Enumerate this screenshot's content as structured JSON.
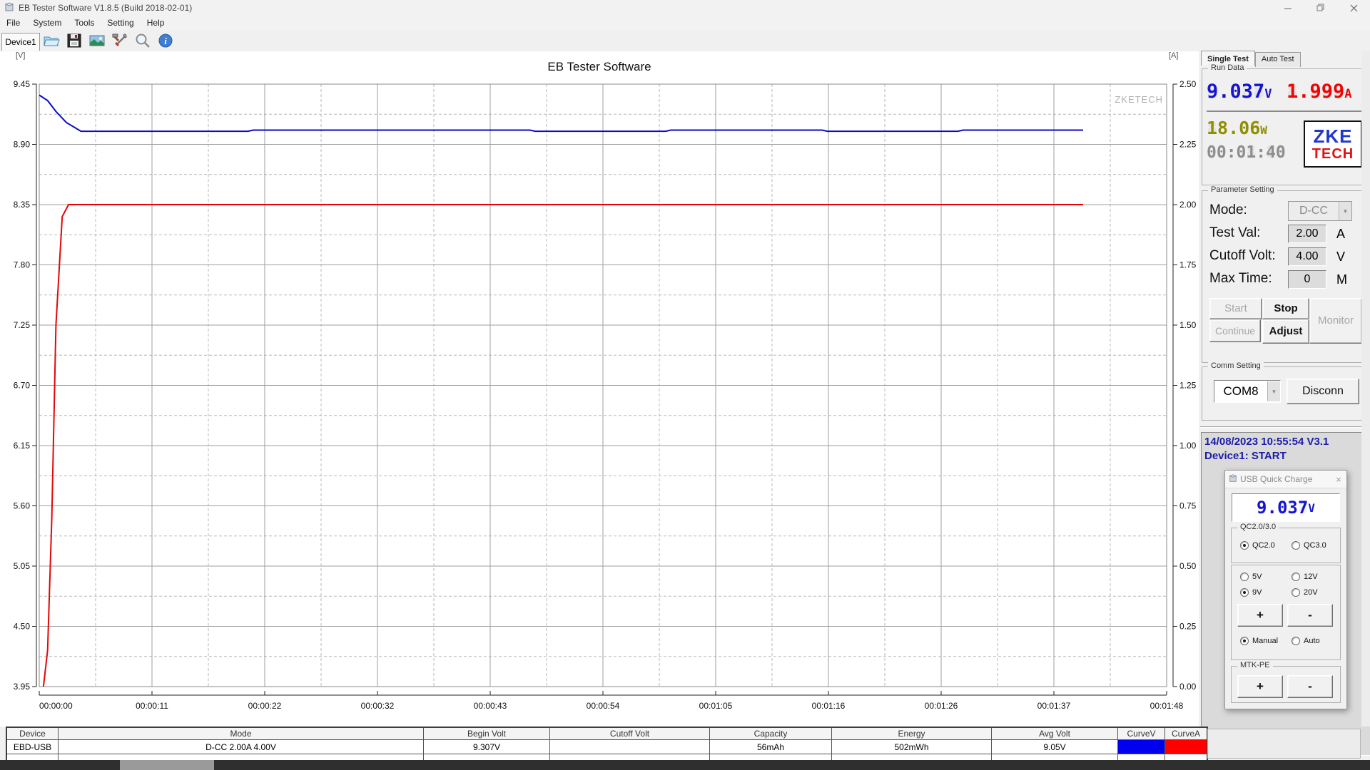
{
  "window": {
    "title": "EB Tester Software V1.8.5 (Build 2018-02-01)"
  },
  "menu": [
    "File",
    "System",
    "Tools",
    "Setting",
    "Help"
  ],
  "toolbar": {
    "device_tab": "Device1",
    "icons": [
      "open-folder-icon",
      "save-icon",
      "image-icon",
      "tools-icon",
      "zoom-icon",
      "info-icon"
    ]
  },
  "chart_data": {
    "type": "line",
    "title": "EB Tester Software",
    "watermark": "ZKETECH",
    "left_axis": {
      "label": "[V]",
      "min": 3.95,
      "max": 9.45,
      "ticks": [
        "9.45",
        "8.90",
        "8.35",
        "7.80",
        "7.25",
        "6.70",
        "6.15",
        "5.60",
        "5.05",
        "4.50",
        "3.95"
      ]
    },
    "right_axis": {
      "label": "[A]",
      "min": 0.0,
      "max": 2.5,
      "ticks": [
        "2.50",
        "2.25",
        "2.00",
        "1.75",
        "1.50",
        "1.25",
        "1.00",
        "0.75",
        "0.50",
        "0.25",
        "0.00"
      ]
    },
    "x_axis": {
      "min": 0,
      "max": 108,
      "tick_seconds": [
        0,
        10.8,
        21.6,
        32.4,
        43.2,
        54,
        64.8,
        75.6,
        86.4,
        97.2,
        108
      ],
      "tick_labels": [
        "00:00:00",
        "00:00:11",
        "00:00:22",
        "00:00:32",
        "00:00:43",
        "00:00:54",
        "00:01:05",
        "00:01:16",
        "00:01:26",
        "00:01:37",
        "00:01:48"
      ]
    },
    "grid": true,
    "series": [
      {
        "name": "Voltage (CurveV)",
        "axis": "left",
        "color": "#0b0bc4",
        "points": [
          [
            0,
            9.35
          ],
          [
            0.8,
            9.3
          ],
          [
            1.6,
            9.2
          ],
          [
            2.6,
            9.1
          ],
          [
            4,
            9.02
          ],
          [
            20,
            9.02
          ],
          [
            20.5,
            9.03
          ],
          [
            47,
            9.03
          ],
          [
            47.5,
            9.02
          ],
          [
            60,
            9.02
          ],
          [
            60.5,
            9.03
          ],
          [
            75,
            9.03
          ],
          [
            75.5,
            9.02
          ],
          [
            88,
            9.02
          ],
          [
            88.5,
            9.03
          ],
          [
            100,
            9.03
          ]
        ]
      },
      {
        "name": "Current (CurveA)",
        "axis": "right",
        "color": "#e40606",
        "points": [
          [
            0.4,
            0.0
          ],
          [
            0.8,
            0.15
          ],
          [
            1.2,
            0.7
          ],
          [
            1.6,
            1.5
          ],
          [
            2.2,
            1.95
          ],
          [
            2.8,
            2.0
          ],
          [
            100,
            2.0
          ]
        ]
      }
    ]
  },
  "right_panel": {
    "tabs": [
      "Single Test",
      "Auto Test"
    ],
    "run_data": {
      "caption": "Run Data",
      "voltage": "9.037",
      "voltage_unit": "V",
      "current": "1.999",
      "current_unit": "A",
      "power": "18.06",
      "power_unit": "W",
      "time": "00:01:40",
      "logo_top": "ZKE",
      "logo_bottom": "TECH"
    },
    "parameter": {
      "caption": "Parameter Setting",
      "mode_label": "Mode:",
      "mode_value": "D-CC",
      "testval_label": "Test Val:",
      "testval_value": "2.00",
      "testval_unit": "A",
      "cutoff_label": "Cutoff Volt:",
      "cutoff_value": "4.00",
      "cutoff_unit": "V",
      "maxtime_label": "Max Time:",
      "maxtime_value": "0",
      "maxtime_unit": "M",
      "buttons": {
        "start": "Start",
        "stop": "Stop",
        "continue": "Continue",
        "adjust": "Adjust",
        "monitor": "Monitor"
      }
    },
    "comm": {
      "caption": "Comm Setting",
      "port": "COM8",
      "disconnect": "Disconn"
    },
    "log": {
      "line1": "14/08/2023 10:55:54  V3.1",
      "line2": "Device1: START"
    }
  },
  "qc_dialog": {
    "title": "USB Quick Charge",
    "close": "×",
    "voltage": "9.037",
    "voltage_unit": "V",
    "group_label": "QC2.0/3.0",
    "radios": {
      "qc20": "QC2.0",
      "qc30": "QC3.0",
      "v5": "5V",
      "v12": "12V",
      "v9": "9V",
      "v20": "20V",
      "manual": "Manual",
      "auto": "Auto"
    },
    "selected": {
      "protocol": "QC2.0",
      "voltage": "9V",
      "mode": "Manual"
    },
    "mtk_label": "MTK-PE",
    "plus": "+",
    "minus": "-"
  },
  "table": {
    "headers": [
      "Device",
      "Mode",
      "Begin Volt",
      "Cutoff Volt",
      "Capacity",
      "Energy",
      "Avg Volt",
      "CurveV",
      "CurveA"
    ],
    "row": [
      "EBD-USB",
      "D-CC 2.00A 4.00V",
      "9.307V",
      "",
      "56mAh",
      "502mWh",
      "9.05V",
      "",
      ""
    ],
    "curve_v_color": "#0000ee",
    "curve_a_color": "#ff0000"
  }
}
